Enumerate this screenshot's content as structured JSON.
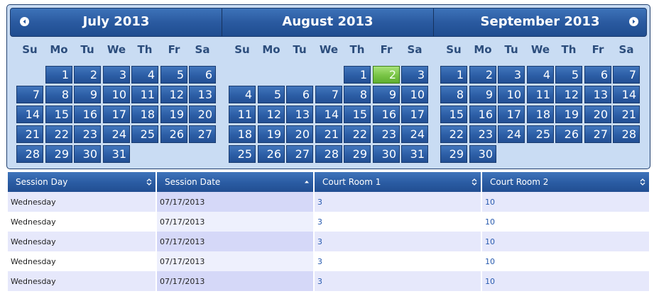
{
  "calendar": {
    "prev_icon": "chevron-left-circle-icon",
    "next_icon": "chevron-right-circle-icon",
    "weekdays": [
      "Su",
      "Mo",
      "Tu",
      "We",
      "Th",
      "Fr",
      "Sa"
    ],
    "selected_date": "August 2",
    "months": [
      {
        "title": "July 2013",
        "weeks": [
          [
            "",
            "1",
            "2",
            "3",
            "4",
            "5",
            "6"
          ],
          [
            "7",
            "8",
            "9",
            "10",
            "11",
            "12",
            "13"
          ],
          [
            "14",
            "15",
            "16",
            "17",
            "18",
            "19",
            "20"
          ],
          [
            "21",
            "22",
            "23",
            "24",
            "25",
            "26",
            "27"
          ],
          [
            "28",
            "29",
            "30",
            "31",
            "",
            "",
            ""
          ]
        ]
      },
      {
        "title": "August 2013",
        "weeks": [
          [
            "",
            "",
            "",
            "",
            "1",
            "2",
            "3"
          ],
          [
            "4",
            "5",
            "6",
            "7",
            "8",
            "9",
            "10"
          ],
          [
            "11",
            "12",
            "13",
            "14",
            "15",
            "16",
            "17"
          ],
          [
            "18",
            "19",
            "20",
            "21",
            "22",
            "23",
            "24"
          ],
          [
            "25",
            "26",
            "27",
            "28",
            "29",
            "30",
            "31"
          ]
        ]
      },
      {
        "title": "September 2013",
        "weeks": [
          [
            "1",
            "2",
            "3",
            "4",
            "5",
            "6",
            "7"
          ],
          [
            "8",
            "9",
            "10",
            "11",
            "12",
            "13",
            "14"
          ],
          [
            "15",
            "16",
            "17",
            "18",
            "19",
            "20",
            "21"
          ],
          [
            "22",
            "23",
            "24",
            "25",
            "26",
            "27",
            "28"
          ],
          [
            "29",
            "30",
            "",
            "",
            "",
            "",
            ""
          ]
        ]
      }
    ]
  },
  "table": {
    "columns": [
      {
        "label": "Session Day",
        "sort": "none"
      },
      {
        "label": "Session Date",
        "sort": "ascending"
      },
      {
        "label": "Court Room 1",
        "sort": "none"
      },
      {
        "label": "Court Room 2",
        "sort": "none"
      }
    ],
    "rows": [
      [
        "Wednesday",
        "07/17/2013",
        "3",
        "10"
      ],
      [
        "Wednesday",
        "07/17/2013",
        "3",
        "10"
      ],
      [
        "Wednesday",
        "07/17/2013",
        "3",
        "10"
      ],
      [
        "Wednesday",
        "07/17/2013",
        "3",
        "10"
      ],
      [
        "Wednesday",
        "07/17/2013",
        "3",
        "10"
      ]
    ]
  },
  "colors": {
    "calendar_background": "#c9dcf3",
    "day_cell": "#2c5ea6",
    "selected_day": "#78c445",
    "header": "#2a5ba2",
    "row_odd": "#e6e8fb",
    "sorted_column": "#d5d8f8",
    "link_text": "#2a5cb0"
  }
}
